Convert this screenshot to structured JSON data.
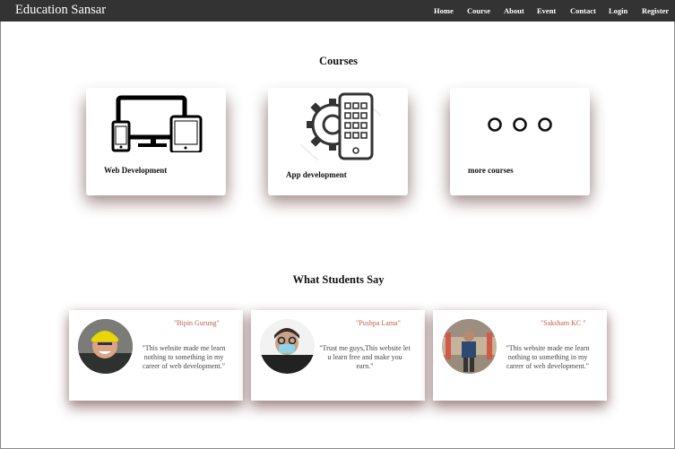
{
  "navbar": {
    "brand": "Education Sansar",
    "items": [
      "Home",
      "Course",
      "About",
      "Event",
      "Contact",
      "Login",
      "Register"
    ]
  },
  "courses": {
    "title": "Courses",
    "cards": [
      {
        "label": "Web Development",
        "icon": "devices-icon"
      },
      {
        "label": "App development",
        "icon": "gear-phone-icon"
      },
      {
        "label": "more courses",
        "icon": "more-dots-icon"
      }
    ]
  },
  "testimonials": {
    "title": "What Students Say",
    "items": [
      {
        "name": "\"Bipin Gurung\"",
        "quote": "\"This website made me learn nothing to something in my career of web development.\""
      },
      {
        "name": "\"Pushpa Lama\"",
        "quote": "\"Trust me guys,This website let u learn free and make you earn.\""
      },
      {
        "name": "\"Saksham KC \"",
        "quote": "\"This website made me learn nothing to something in my career of web development.\""
      }
    ]
  }
}
